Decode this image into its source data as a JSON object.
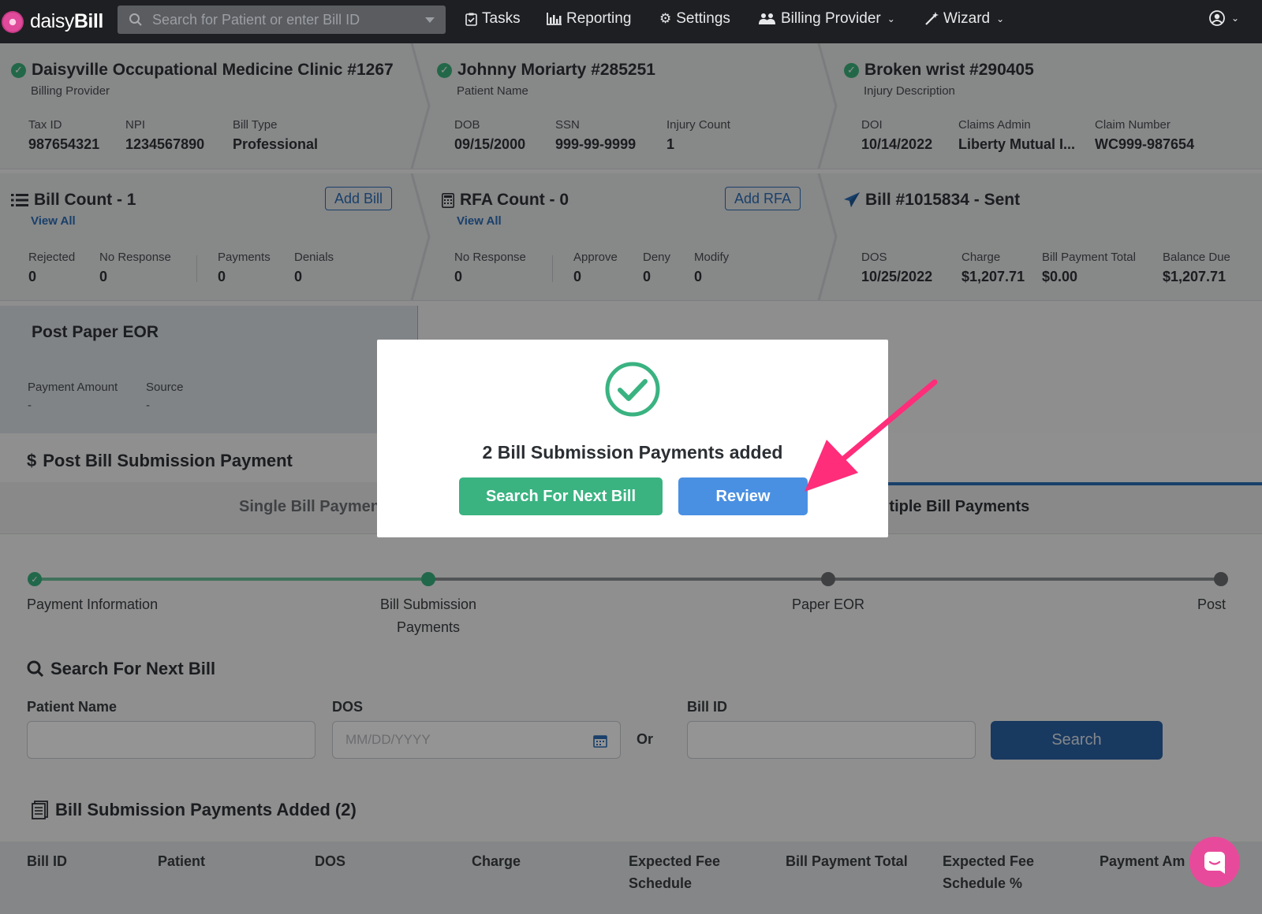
{
  "navbar": {
    "brand_prefix": "daisy",
    "brand_suffix": "Bill",
    "search_placeholder": "Search for Patient or enter Bill ID",
    "tasks": "Tasks",
    "reporting": "Reporting",
    "settings": "Settings",
    "billing_provider": "Billing Provider",
    "wizard": "Wizard"
  },
  "provider": {
    "title": "Daisyville Occupational Medicine Clinic #1267",
    "subtitle": "Billing Provider",
    "tax_id_label": "Tax ID",
    "tax_id": "987654321",
    "npi_label": "NPI",
    "npi": "1234567890",
    "bill_type_label": "Bill Type",
    "bill_type": "Professional"
  },
  "patient": {
    "title": "Johnny Moriarty #285251",
    "subtitle": "Patient Name",
    "dob_label": "DOB",
    "dob": "09/15/2000",
    "ssn_label": "SSN",
    "ssn": "999-99-9999",
    "injury_count_label": "Injury Count",
    "injury_count": "1"
  },
  "injury": {
    "title": "Broken wrist #290405",
    "subtitle": "Injury Description",
    "doi_label": "DOI",
    "doi": "10/14/2022",
    "claims_admin_label": "Claims Admin",
    "claims_admin": "Liberty Mutual I...",
    "claim_number_label": "Claim Number",
    "claim_number": "WC999-987654"
  },
  "bills": {
    "title": "Bill Count - 1",
    "view_all": "View All",
    "add_label": "Add Bill",
    "rejected_label": "Rejected",
    "rejected": "0",
    "no_response_label": "No Response",
    "no_response": "0",
    "payments_label": "Payments",
    "payments": "0",
    "denials_label": "Denials",
    "denials": "0"
  },
  "rfa": {
    "title": "RFA Count - 0",
    "view_all": "View All",
    "add_label": "Add RFA",
    "no_response_label": "No Response",
    "no_response": "0",
    "approve_label": "Approve",
    "approve": "0",
    "deny_label": "Deny",
    "deny": "0",
    "modify_label": "Modify",
    "modify": "0"
  },
  "bill": {
    "title": "Bill #1015834 - Sent",
    "dos_label": "DOS",
    "dos": "10/25/2022",
    "charge_label": "Charge",
    "charge": "$1,207.71",
    "payment_total_label": "Bill Payment Total",
    "payment_total": "$0.00",
    "balance_label": "Balance Due",
    "balance": "$1,207.71"
  },
  "eor": {
    "title": "Post Paper EOR",
    "payment_amount_label": "Payment Amount",
    "payment_amount": "-",
    "source_label": "Source",
    "source": "-"
  },
  "post_payment": {
    "title": "Post Bill Submission Payment",
    "tab_single": "Single Bill Payment",
    "tab_multiple": "Multiple Bill Payments"
  },
  "stepper": {
    "step1": "Payment Information",
    "step2": "Bill Submission Payments",
    "step3": "Paper EOR",
    "step4": "Post"
  },
  "search_next": {
    "title": "Search For Next Bill",
    "patient_name_label": "Patient Name",
    "dos_label": "DOS",
    "dos_placeholder": "MM/DD/YYYY",
    "or_label": "Or",
    "bill_id_label": "Bill ID",
    "search_button": "Search"
  },
  "added": {
    "title": "Bill Submission Payments Added (2)",
    "columns": [
      "Bill ID",
      "Patient",
      "DOS",
      "Charge",
      "Expected Fee Schedule",
      "Bill Payment Total",
      "Expected Fee Schedule %",
      "Payment Am"
    ]
  },
  "modal": {
    "message": "2 Bill Submission Payments added",
    "primary_button": "Search For Next Bill",
    "review_button": "Review"
  },
  "colors": {
    "success": "#3ab381",
    "primary": "#4a90e2",
    "arrow": "#ff2d7a",
    "chat": "#e84a9b"
  }
}
